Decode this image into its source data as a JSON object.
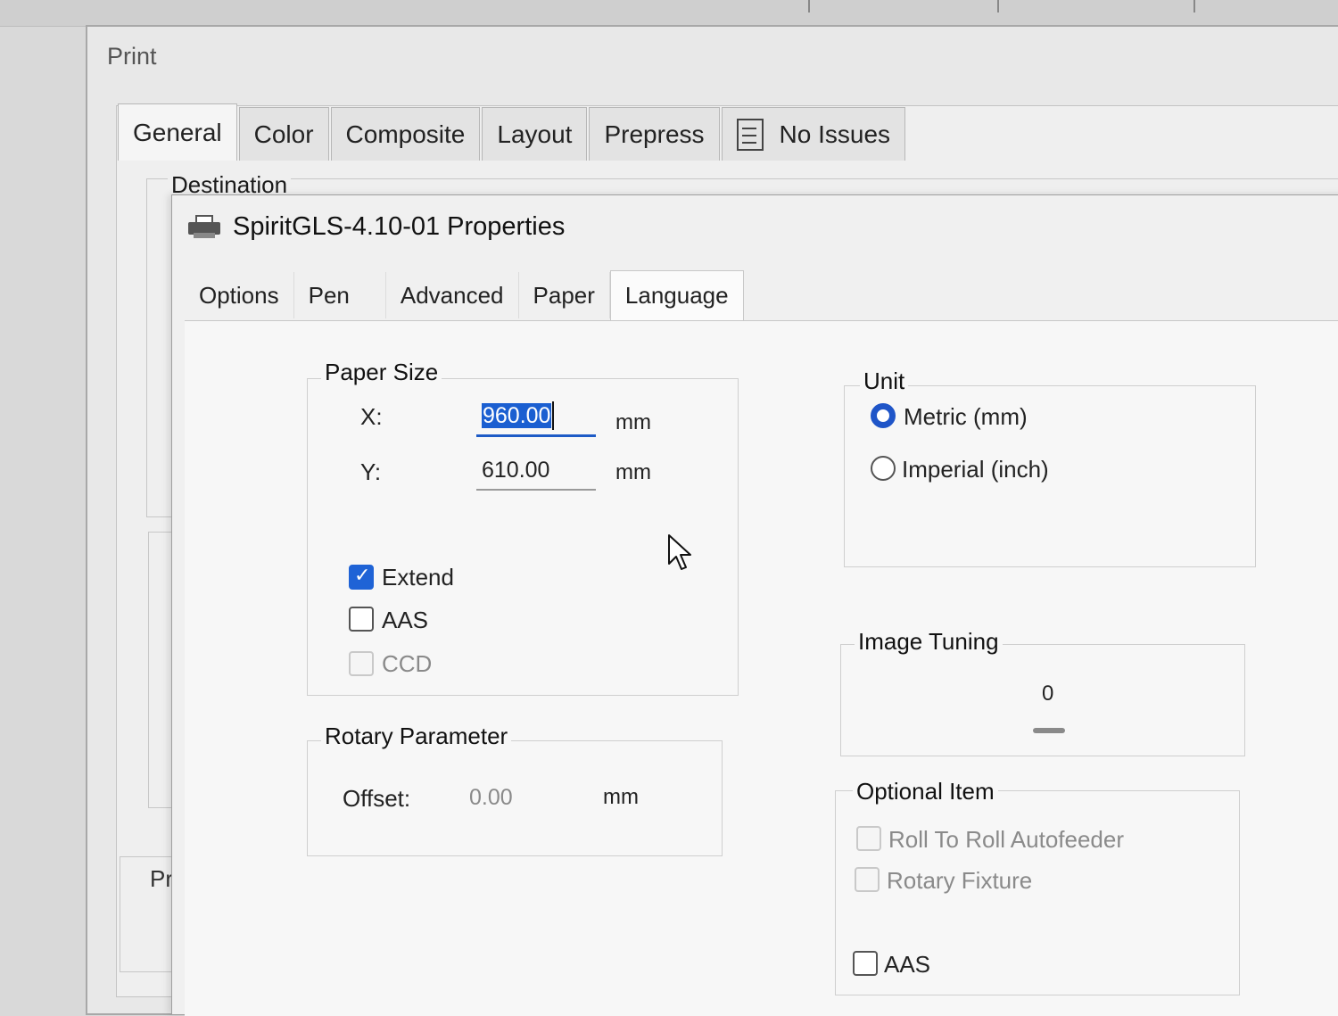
{
  "print_dialog": {
    "title": "Print",
    "tabs": [
      "General",
      "Color",
      "Composite",
      "Layout",
      "Prepress"
    ],
    "issues_tab": "No Issues",
    "destination_label": "Destination",
    "partial_label": "Pr"
  },
  "properties_dialog": {
    "title": "SpiritGLS-4.10-01 Properties",
    "tabs": [
      "Options",
      "Pen",
      "Advanced",
      "Paper",
      "Language"
    ],
    "active_tab": "Paper",
    "paper_size": {
      "label": "Paper Size",
      "x_label": "X:",
      "x_value": "960.00",
      "y_label": "Y:",
      "y_value": "610.00",
      "unit": "mm",
      "checkboxes": [
        {
          "label": "Extend",
          "checked": true,
          "enabled": true
        },
        {
          "label": "AAS",
          "checked": false,
          "enabled": true
        },
        {
          "label": "CCD",
          "checked": false,
          "enabled": false
        }
      ]
    },
    "unit": {
      "label": "Unit",
      "options": [
        {
          "label": "Metric (mm)",
          "selected": true
        },
        {
          "label": "Imperial (inch)",
          "selected": false
        }
      ]
    },
    "image_tuning": {
      "label": "Image Tuning",
      "value": "0"
    },
    "rotary_parameter": {
      "label": "Rotary Parameter",
      "offset_label": "Offset:",
      "offset_value": "0.00",
      "unit": "mm"
    },
    "optional_item": {
      "label": "Optional Item",
      "items": [
        {
          "label": "Roll To Roll  Autofeeder",
          "checked": false,
          "enabled": false
        },
        {
          "label": "Rotary Fixture",
          "checked": false,
          "enabled": false
        },
        {
          "label": "AAS",
          "checked": false,
          "enabled": true
        }
      ]
    }
  },
  "colors": {
    "accent": "#1f63d6",
    "selection": "#1b5fd1"
  }
}
